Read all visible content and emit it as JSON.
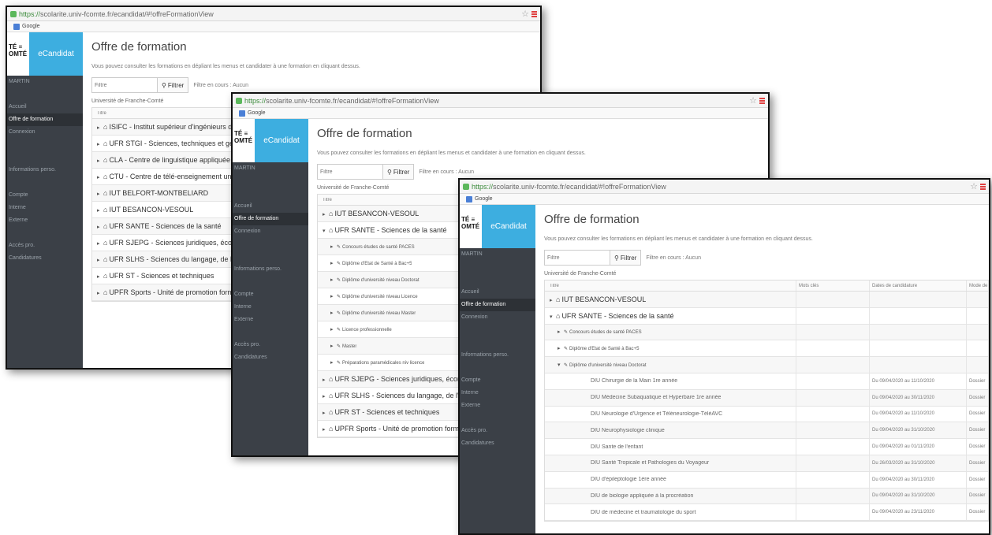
{
  "common": {
    "url_secure": "https://",
    "url_rest": "scolarite.univ-fcomte.fr/ecandidat/#!offreFormationView",
    "bookmark": "Google",
    "brand_left": "TÉ ≡\nOMTÉ",
    "brand_name": "eCandidat",
    "page_title": "Offre de formation",
    "subtitle": "Vous pouvez consulter les formations en dépliant les menus et candidater à une formation en cliquant dessus.",
    "filter_placeholder": "Filtre",
    "filter_button": "Filtrer",
    "filter_status": "Filtre en cours : Aucun",
    "university": "Université de Franche-Comté",
    "col_title": "Titre",
    "col_keywords": "Mots clés",
    "col_dates": "Dates de candidature",
    "col_mode": "Mode de"
  },
  "sidebar": {
    "user": "MARTIN",
    "items": [
      "Accueil",
      "Offre de formation",
      "Connexion",
      "",
      "Informations perso.",
      "Candidatures",
      "Compte",
      "Interne",
      "Externe",
      "",
      "Accès pro.",
      "Candidatures"
    ]
  },
  "window1": {
    "sidebar_items": [
      "MARTIN",
      "",
      "Accueil",
      "Offre de formation",
      "Connexion",
      "",
      "",
      "Informations perso.",
      "",
      "Compte",
      "Interne",
      "Externe",
      "",
      "Accès pro.",
      "Candidatures"
    ],
    "rows": [
      "ISIFC - Institut supérieur d'ingénieurs de Franche-Comté",
      "UFR STGI - Sciences, techniques et gestion de l'industrie",
      "CLA - Centre de linguistique appliquée",
      "CTU - Centre de télé-enseignement universitaire",
      "IUT BELFORT-MONTBELIARD",
      "IUT BESANCON-VESOUL",
      "UFR SANTE - Sciences de la santé",
      "UFR SJEPG - Sciences juridiques, économiques, politiques et de gestion",
      "UFR SLHS - Sciences du langage, de l'homme et de la société",
      "UFR ST - Sciences et techniques",
      "UPFR Sports - Unité de promotion formation et recherche"
    ]
  },
  "window2": {
    "sidebar_items": [
      "MARTIN",
      "",
      "",
      "Accueil",
      "Offre de formation",
      "Connexion",
      "",
      "",
      "Informations perso.",
      "",
      "Compte",
      "Interne",
      "Externe",
      "",
      "Accès pro.",
      "Candidatures"
    ],
    "rows": [
      {
        "level": 1,
        "arrow": "▸",
        "text": "IUT BESANCON-VESOUL"
      },
      {
        "level": 1,
        "arrow": "▾",
        "text": "UFR SANTE - Sciences de la santé"
      },
      {
        "level": 2,
        "arrow": "▸",
        "text": "Concours études de santé PACES"
      },
      {
        "level": 2,
        "arrow": "▸",
        "text": "Diplôme d'Etat de Santé à Bac+5"
      },
      {
        "level": 2,
        "arrow": "▸",
        "text": "Diplôme d'université niveau Doctorat"
      },
      {
        "level": 2,
        "arrow": "▸",
        "text": "Diplôme d'université niveau Licence"
      },
      {
        "level": 2,
        "arrow": "▸",
        "text": "Diplôme d'université niveau Master"
      },
      {
        "level": 2,
        "arrow": "▸",
        "text": "Licence professionnelle"
      },
      {
        "level": 2,
        "arrow": "▸",
        "text": "Master"
      },
      {
        "level": 2,
        "arrow": "▸",
        "text": "Préparations paramédicales niv licence"
      },
      {
        "level": 1,
        "arrow": "▸",
        "text": "UFR SJEPG - Sciences juridiques, économiques, politiques et de gestion"
      },
      {
        "level": 1,
        "arrow": "▸",
        "text": "UFR SLHS - Sciences du langage, de l'homme et de la société"
      },
      {
        "level": 1,
        "arrow": "▸",
        "text": "UFR ST - Sciences et techniques"
      },
      {
        "level": 1,
        "arrow": "▸",
        "text": "UPFR Sports - Unité de promotion formation et recherche"
      }
    ]
  },
  "window3": {
    "sidebar_items": [
      "MARTIN",
      "",
      "",
      "Accueil",
      "Offre de formation",
      "Connexion",
      "",
      "",
      "Informations perso.",
      "",
      "Compte",
      "Interne",
      "Externe",
      "",
      "Accès pro.",
      "Candidatures"
    ],
    "rows": [
      {
        "level": 1,
        "arrow": "▸",
        "text": "IUT BESANCON-VESOUL",
        "dates": "",
        "mode": ""
      },
      {
        "level": 1,
        "arrow": "▾",
        "text": "UFR SANTE - Sciences de la santé",
        "dates": "",
        "mode": ""
      },
      {
        "level": 2,
        "arrow": "▸",
        "text": "Concours études de santé PACES",
        "dates": "",
        "mode": ""
      },
      {
        "level": 2,
        "arrow": "▸",
        "text": "Diplôme d'Etat de Santé à Bac+5",
        "dates": "",
        "mode": ""
      },
      {
        "level": 2,
        "arrow": "▾",
        "text": "Diplôme d'université niveau Doctorat",
        "dates": "",
        "mode": ""
      },
      {
        "level": 3,
        "arrow": "",
        "text": "DIU Chirurgie de la Main 1re année",
        "dates": "Du 09/04/2020 au 11/10/2020",
        "mode": "Dossier"
      },
      {
        "level": 3,
        "arrow": "",
        "text": "DIU Médecine Subaquatique et Hyperbare 1re année",
        "dates": "Du 09/04/2020 au 30/11/2020",
        "mode": "Dossier"
      },
      {
        "level": 3,
        "arrow": "",
        "text": "DIU Neurologie d'Urgence et Téléneurologie-TéléAVC",
        "dates": "Du 09/04/2020 au 11/10/2020",
        "mode": "Dossier"
      },
      {
        "level": 3,
        "arrow": "",
        "text": "DIU Neurophysiologie clinique",
        "dates": "Du 09/04/2020 au 31/10/2020",
        "mode": "Dossier"
      },
      {
        "level": 3,
        "arrow": "",
        "text": "DIU Sante de l'enfant",
        "dates": "Du 09/04/2020 au 01/11/2020",
        "mode": "Dossier"
      },
      {
        "level": 3,
        "arrow": "",
        "text": "DIU Santé Tropicale et Pathologies du Voyageur",
        "dates": "Du 26/03/2020 au 31/10/2020",
        "mode": "Dossier"
      },
      {
        "level": 3,
        "arrow": "",
        "text": "DIU d'épileptologie 1ère année",
        "dates": "Du 09/04/2020 au 30/11/2020",
        "mode": "Dossier"
      },
      {
        "level": 3,
        "arrow": "",
        "text": "DIU de biologie appliquée à la procréation",
        "dates": "Du 09/04/2020 au 31/10/2020",
        "mode": "Dossier"
      },
      {
        "level": 3,
        "arrow": "",
        "text": "DIU de médecine et traumatologie du sport",
        "dates": "Du 09/04/2020 au 23/11/2020",
        "mode": "Dossier"
      }
    ]
  },
  "colors": {
    "sidebar": "#3b4047",
    "brand": "#3daee0",
    "secure_url": "#3a8a3a",
    "browser_menu": "#e04040"
  },
  "icons": {
    "institution": "bank-icon",
    "category": "graduation-cap-icon",
    "expand": "chevron-right-icon",
    "collapse": "chevron-down-icon",
    "filter": "search-icon"
  }
}
